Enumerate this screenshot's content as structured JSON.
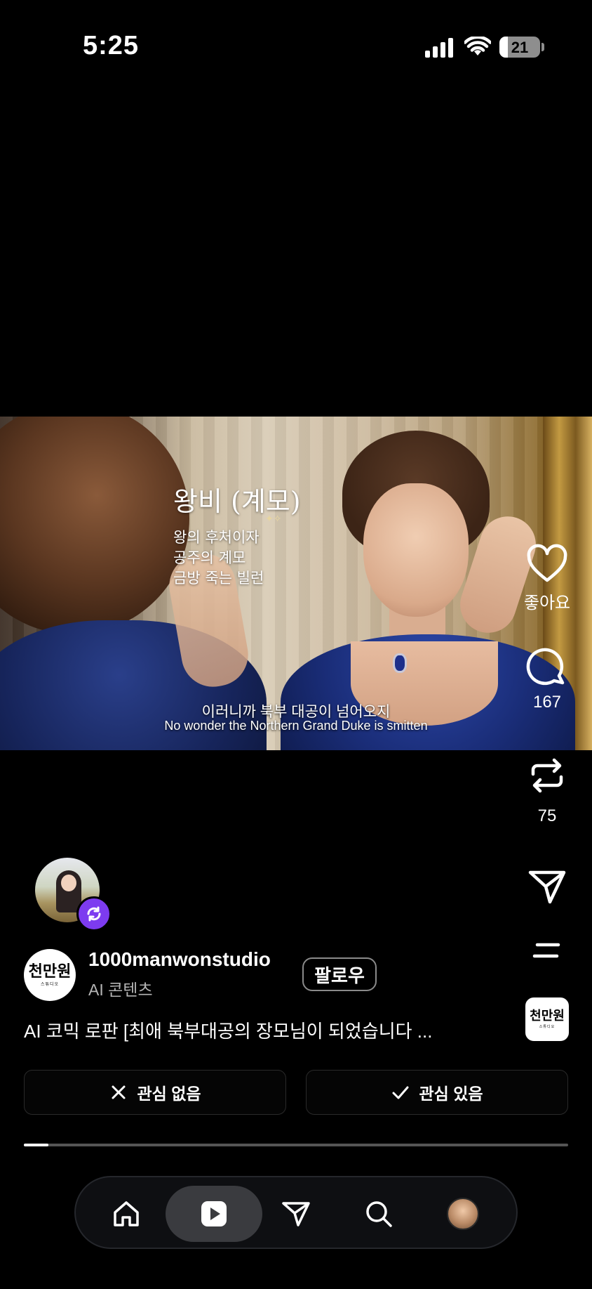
{
  "status_bar": {
    "time": "5:25",
    "battery": "21"
  },
  "video": {
    "overlay_title": "왕비 (계모)",
    "overlay_lines": [
      "왕의 후처이자",
      "공주의 계모",
      "금방 죽는 빌런"
    ],
    "subtitle_ko": "이러니까 북부 대공이 넘어오지",
    "subtitle_en": "No wonder the Northern Grand Duke is smitten"
  },
  "actions": {
    "like_label": "좋아요",
    "comment_count": "167",
    "repost_count": "75"
  },
  "author": {
    "logo_text": "천만원",
    "logo_subtext": "스튜디오",
    "name": "1000manwonstudio",
    "category": "AI 콘텐츠",
    "follow_label": "팔로우"
  },
  "caption": "AI 코믹 로판 [최애 북부대공의 장모님이 되었습니다 ...",
  "interest": {
    "not_interested": "관심 없음",
    "interested": "관심 있음"
  },
  "progress": {
    "fraction": 0.045
  },
  "nav": [
    "home-icon",
    "reels-icon",
    "send-icon",
    "search-icon",
    "profile-avatar"
  ],
  "colors": {
    "remix_badge": "#7d3bf0",
    "background": "#000000"
  }
}
